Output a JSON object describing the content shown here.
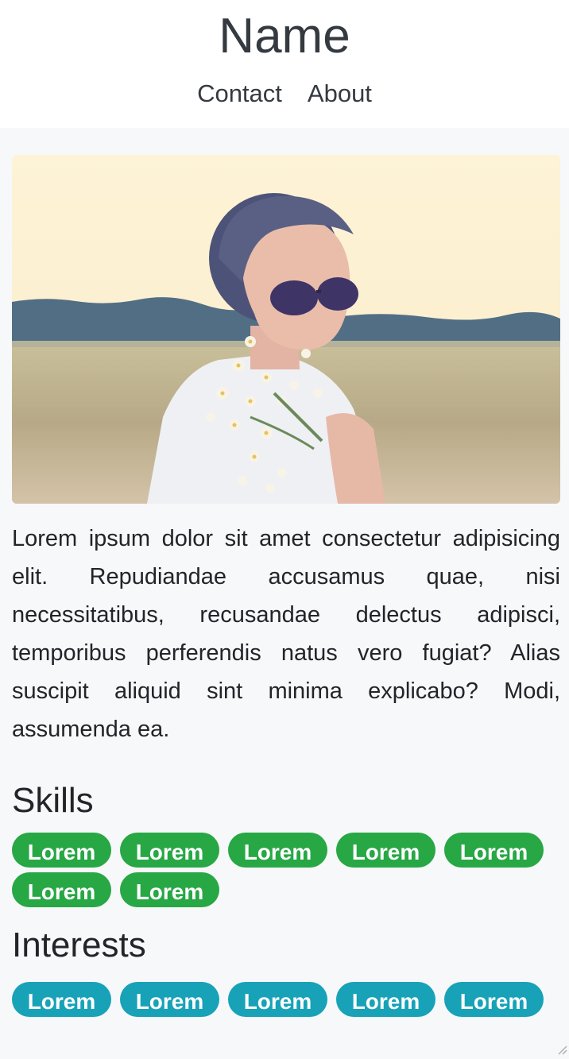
{
  "header": {
    "name": "Name",
    "nav": [
      {
        "label": "Contact"
      },
      {
        "label": "About"
      }
    ]
  },
  "profile": {
    "photo_icon": "portrait-photo",
    "bio": "Lorem ipsum dolor sit amet consectetur adipisicing elit. Repudiandae accusamus quae, nisi necessitatibus, recusandae delectus adipisci, temporibus perferendis natus vero fugiat? Alias suscipit aliquid sint minima explicabo? Modi, assumenda ea."
  },
  "skills": {
    "title": "Skills",
    "items": [
      "Lorem",
      "Lorem",
      "Lorem",
      "Lorem",
      "Lorem",
      "Lorem",
      "Lorem"
    ],
    "color": "#28a745"
  },
  "interests": {
    "title": "Interests",
    "items": [
      "Lorem",
      "Lorem",
      "Lorem",
      "Lorem",
      "Lorem"
    ],
    "color": "#17a2b8"
  }
}
